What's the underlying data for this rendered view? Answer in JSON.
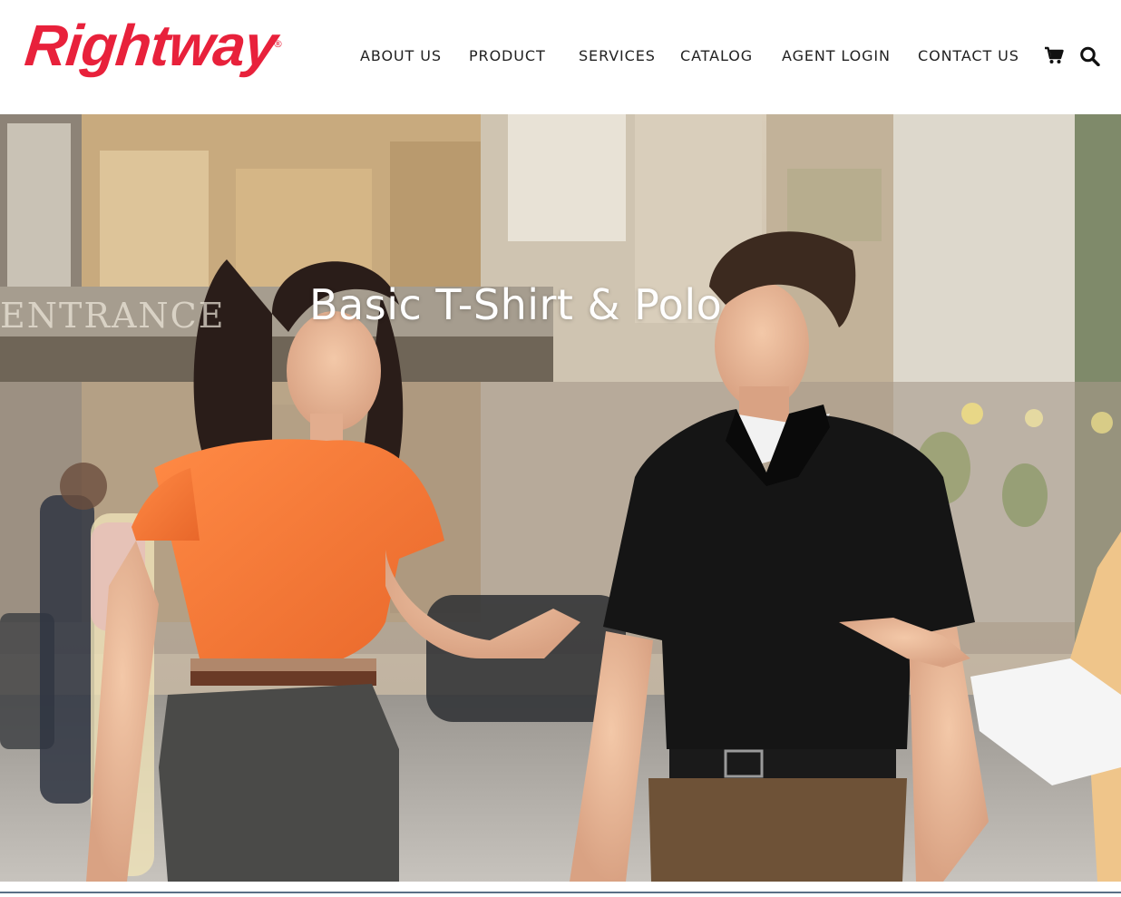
{
  "brand": {
    "name": "Rightway",
    "registered_mark": "®",
    "color": "#e8213b"
  },
  "nav": {
    "items": [
      {
        "label": "ABOUT US"
      },
      {
        "label": "PRODUCT"
      },
      {
        "label": "SERVICES"
      },
      {
        "label": "CATALOG"
      },
      {
        "label": "AGENT LOGIN"
      },
      {
        "label": "CONTACT US"
      }
    ],
    "icons": [
      "cart-icon",
      "search-icon"
    ]
  },
  "hero": {
    "title": "Basic T-Shirt & Polo",
    "background_sign": "ENTRANCE"
  },
  "colors": {
    "text": "#222222",
    "hero_title": "#ffffff",
    "orange_tee": "#f47a35",
    "black_polo": "#151515",
    "footer_line": "#5a6f86"
  }
}
